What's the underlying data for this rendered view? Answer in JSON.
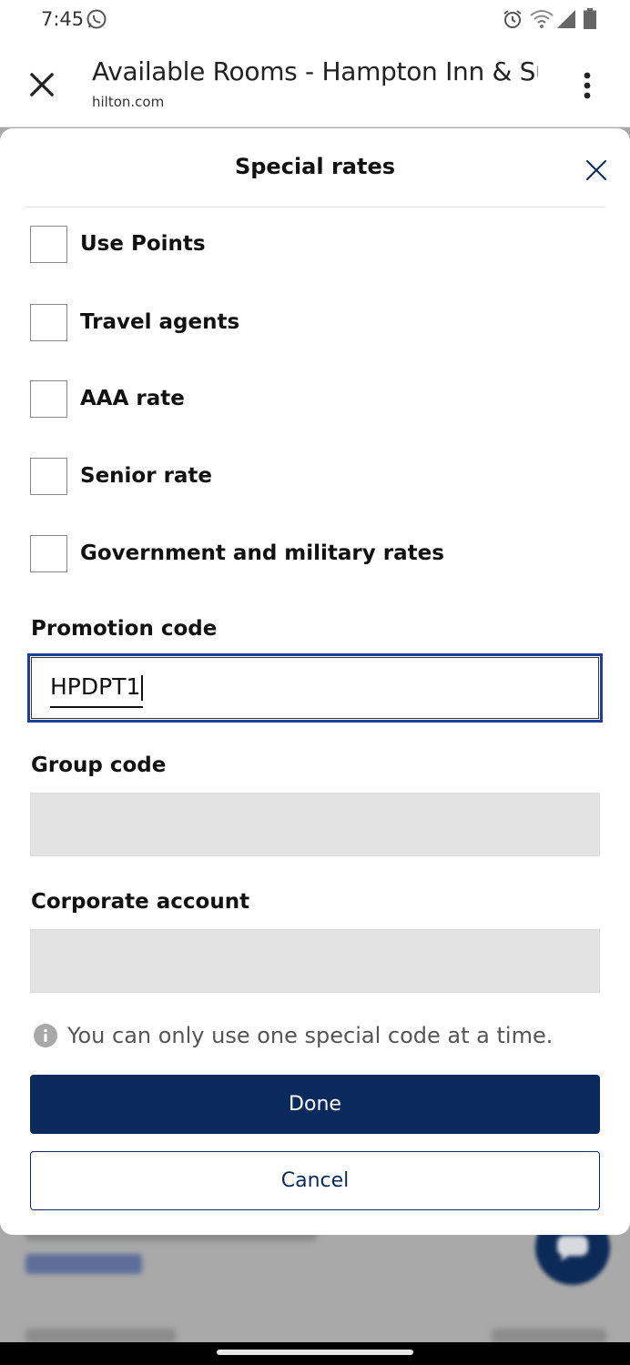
{
  "status_bar": {
    "time": "7:45"
  },
  "browser": {
    "title": "Available Rooms - Hampton Inn & Suite...",
    "url": "hilton.com"
  },
  "modal": {
    "title": "Special rates",
    "checkboxes": [
      {
        "label": "Use Points",
        "checked": false
      },
      {
        "label": "Travel agents",
        "checked": false
      },
      {
        "label": "AAA rate",
        "checked": false
      },
      {
        "label": "Senior rate",
        "checked": false
      },
      {
        "label": "Government and military rates",
        "checked": false
      }
    ],
    "promotion_code": {
      "label": "Promotion code",
      "value": "HPDPT1"
    },
    "group_code": {
      "label": "Group code",
      "value": ""
    },
    "corporate_account": {
      "label": "Corporate account",
      "value": ""
    },
    "info_text": "You can only use one special code at a time.",
    "done_label": "Done",
    "cancel_label": "Cancel"
  },
  "colors": {
    "primary": "#0a2a5e",
    "focus_border": "#1f3f94",
    "disabled_field": "#e3e3e3"
  },
  "icons": [
    "whatsapp-icon",
    "alarm-icon",
    "wifi-icon",
    "signal-icon",
    "battery-icon",
    "close-icon",
    "more-vert-icon",
    "info-icon",
    "chat-icon"
  ]
}
